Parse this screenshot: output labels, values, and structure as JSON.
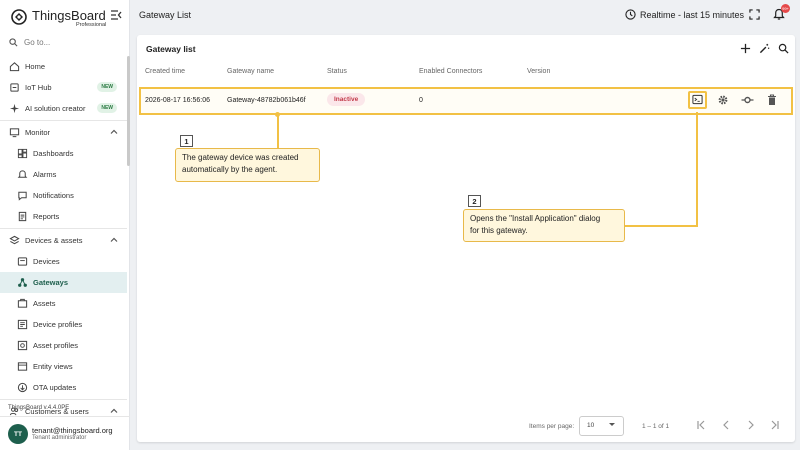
{
  "brand": {
    "name": "ThingsBoard",
    "edition": "Professional"
  },
  "search": {
    "placeholder": "Go to..."
  },
  "nav": [
    {
      "label": "Home",
      "icon": "home-icon",
      "type": "top"
    },
    {
      "label": "IoT Hub",
      "icon": "iot-hub-icon",
      "type": "top",
      "badge": "NEW"
    },
    {
      "label": "AI solution creator",
      "icon": "sparkle-icon",
      "type": "top",
      "badge": "NEW"
    },
    {
      "label": "Monitor",
      "icon": "monitor-icon",
      "type": "group"
    },
    {
      "label": "Dashboards",
      "icon": "dashboard-icon",
      "type": "sub"
    },
    {
      "label": "Alarms",
      "icon": "alarm-icon",
      "type": "sub"
    },
    {
      "label": "Notifications",
      "icon": "notification-icon",
      "type": "sub"
    },
    {
      "label": "Reports",
      "icon": "report-icon",
      "type": "sub"
    },
    {
      "label": "Devices & assets",
      "icon": "devices-assets-icon",
      "type": "group"
    },
    {
      "label": "Devices",
      "icon": "device-icon",
      "type": "sub"
    },
    {
      "label": "Gateways",
      "icon": "gateway-icon",
      "type": "sub",
      "active": true
    },
    {
      "label": "Assets",
      "icon": "asset-icon",
      "type": "sub"
    },
    {
      "label": "Device profiles",
      "icon": "device-profile-icon",
      "type": "sub"
    },
    {
      "label": "Asset profiles",
      "icon": "asset-profile-icon",
      "type": "sub"
    },
    {
      "label": "Entity views",
      "icon": "entity-view-icon",
      "type": "sub"
    },
    {
      "label": "OTA updates",
      "icon": "ota-icon",
      "type": "sub"
    },
    {
      "label": "Customers & users",
      "icon": "customers-icon",
      "type": "group"
    }
  ],
  "footer": {
    "version": "ThingsBoard v.4.4.0PE"
  },
  "user": {
    "initials": "TT",
    "email": "tenant@thingsboard.org",
    "role": "Tenant administrator"
  },
  "header": {
    "title": "Gateway List",
    "realtime": "Realtime - last 15 minutes",
    "notifications_count": "99+"
  },
  "card": {
    "title": "Gateway list",
    "columns": [
      "Created time",
      "Gateway name",
      "Status",
      "Enabled Connectors",
      "Version"
    ],
    "rows": [
      {
        "created": "2026-08-17 16:56:06",
        "name": "Gateway-48782b061b46f",
        "status": "Inactive",
        "connectors": "0",
        "version": ""
      }
    ]
  },
  "paginator": {
    "label": "Items per page:",
    "page_size": "10",
    "range": "1 – 1 of 1"
  },
  "callouts": [
    {
      "number": "1",
      "text_line1": "The gateway device was created",
      "text_line2": "automatically by the agent."
    },
    {
      "number": "2",
      "text_line1": "Opens the \"Install Application\" dialog",
      "text_line2": "for this gateway."
    }
  ],
  "colors": {
    "accent": "#f2c144",
    "primary": "#1e5f4d",
    "inactive": "#c23a4a"
  }
}
